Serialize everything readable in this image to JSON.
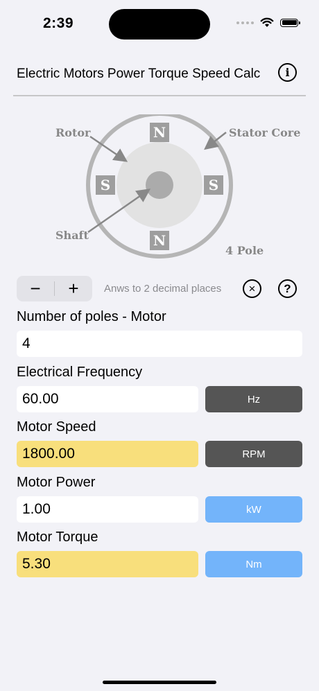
{
  "status_bar": {
    "time": "2:39"
  },
  "header": {
    "title": "Electric Motors Power Torque Speed Calc"
  },
  "diagram": {
    "rotor_label": "Rotor",
    "stator_label": "Stator Core",
    "shaft_label": "Shaft",
    "pole_label": "4 Pole",
    "pole_top": "N",
    "pole_bottom": "N",
    "pole_left": "S",
    "pole_right": "S"
  },
  "controls": {
    "minus_label": "−",
    "plus_label": "+",
    "decimal_note": "Anws to 2 decimal places",
    "clear_icon": "×",
    "help_icon": "?"
  },
  "fields": [
    {
      "label": "Number of poles - Motor",
      "value": "4"
    },
    {
      "label": "Electrical Frequency",
      "value": "60.00",
      "unit": "Hz",
      "unit_color": "#555555"
    },
    {
      "label": "Motor Speed",
      "value": "1800.00",
      "unit": "RPM",
      "unit_color": "#555555"
    },
    {
      "label": "Motor Power",
      "value": "1.00",
      "unit": "kW",
      "unit_color": "#73b4fa"
    },
    {
      "label": "Motor Torque",
      "value": "5.30",
      "unit": "Nm",
      "unit_color": "#73b4fa"
    }
  ],
  "colors": {
    "result_field": "#f8df7c",
    "background": "#f2f2f7"
  }
}
